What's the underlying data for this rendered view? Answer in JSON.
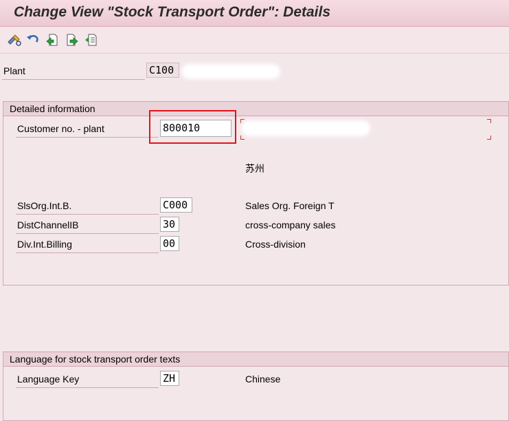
{
  "window": {
    "title": "Change View \"Stock Transport Order\": Details"
  },
  "toolbar": {
    "buttons": [
      {
        "icon": "display-change-icon"
      },
      {
        "icon": "undo-icon"
      },
      {
        "icon": "previous-entry-icon"
      },
      {
        "icon": "next-entry-icon"
      },
      {
        "icon": "variable-list-icon"
      }
    ]
  },
  "plant": {
    "label": "Plant",
    "value": "C100"
  },
  "detailed": {
    "header": "Detailed information",
    "customer_label": "Customer no. - plant",
    "customer_value": "800010",
    "city": "苏州",
    "sales_org_label": "SlsOrg.Int.B.",
    "sales_org_value": "C000",
    "sales_org_desc": "Sales Org. Foreign T",
    "dist_label": "DistChannelIB",
    "dist_value": "30",
    "dist_desc": "cross-company sales",
    "div_label": "Div.Int.Billing",
    "div_value": "00",
    "div_desc": "Cross-division"
  },
  "language": {
    "header": "Language for stock transport order texts",
    "key_label": "Language Key",
    "key_value": "ZH",
    "key_desc": "Chinese"
  },
  "colors": {
    "background": "#f3e7ea",
    "highlight": "#e0131a"
  }
}
